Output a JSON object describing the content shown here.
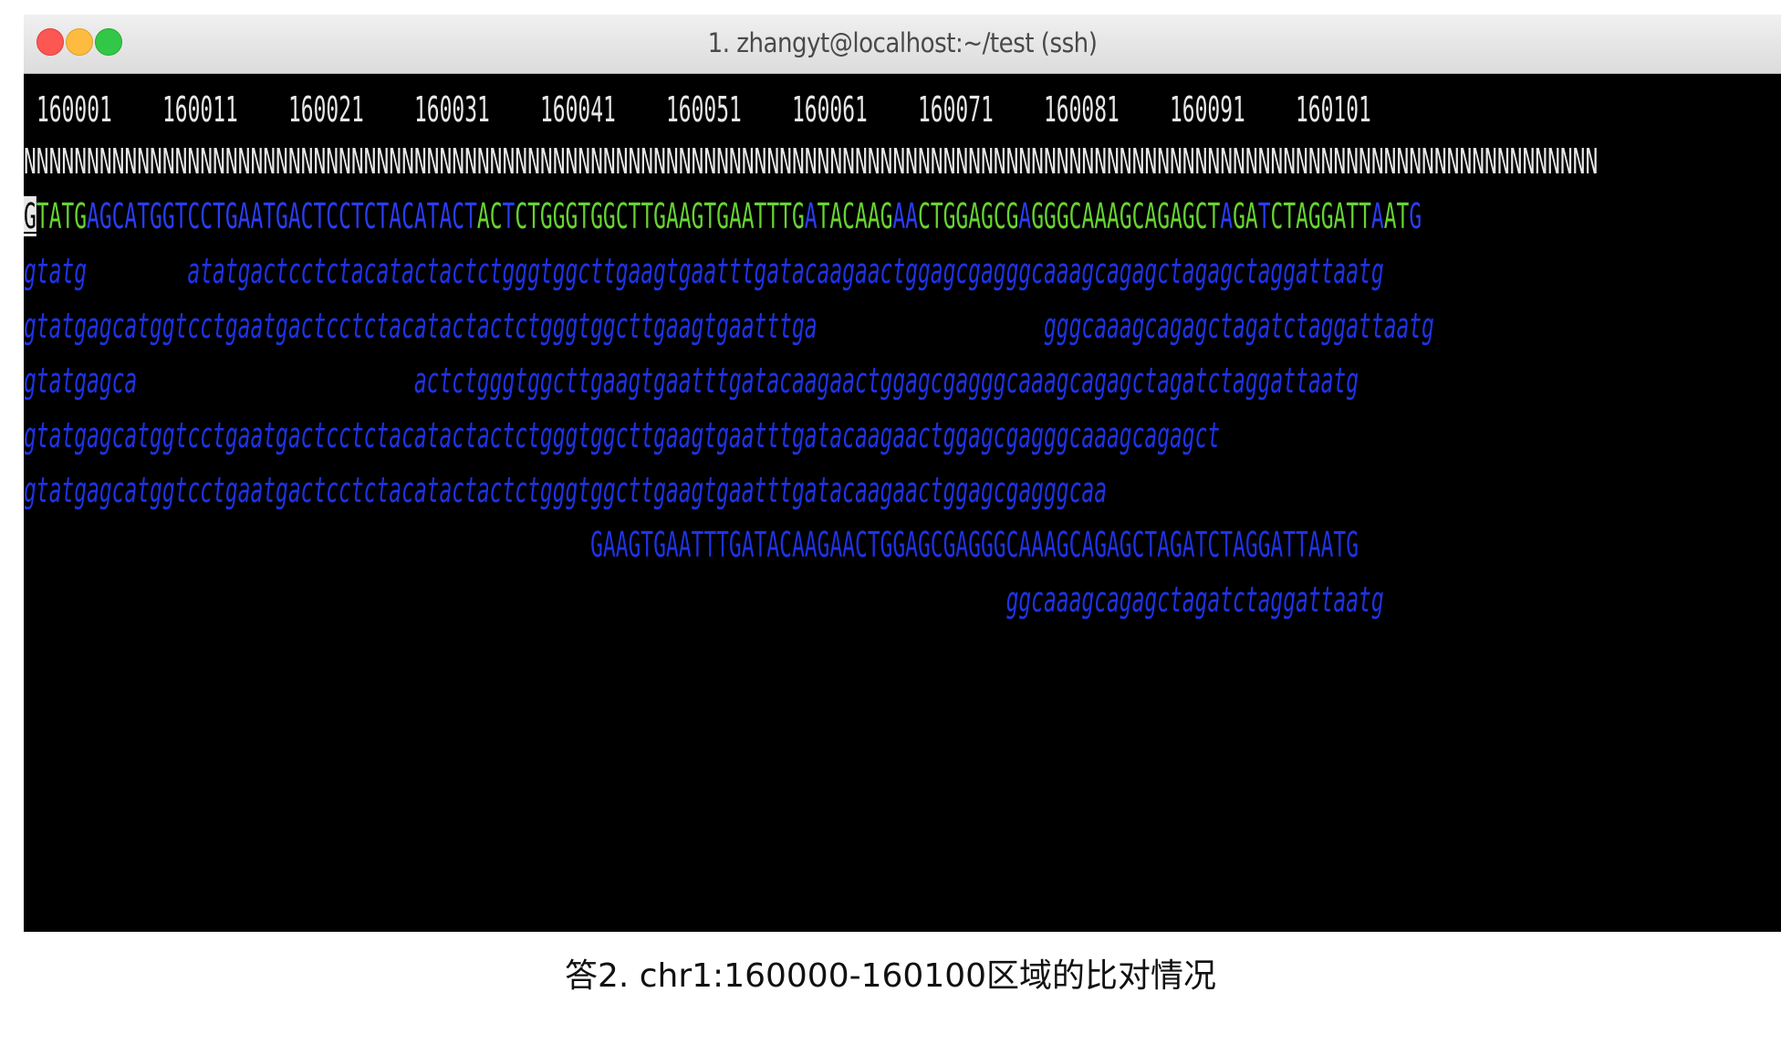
{
  "window": {
    "title": "1. zhangyt@localhost:~/test (ssh)"
  },
  "ruler": [
    "160001",
    "160011",
    "160021",
    "160031",
    "160041",
    "160051",
    "160061",
    "160071",
    "160081",
    "160091",
    "160101"
  ],
  "reference_n": "NNNNNNNNNNNNNNNNNNNNNNNNNNNNNNNNNNNNNNNNNNNNNNNNNNNNNNNNNNNNNNNNNNNNNNNNNNNNNNNNNNNNNNNNNNNNNNNNNNNNNNNNNNNNNNNNNNNNNNNNNNNNN",
  "reference_segments": [
    {
      "text": "G",
      "color": "cursor"
    },
    {
      "text": "TATG",
      "color": "green"
    },
    {
      "text": "AGCATGGTCCTGAATGACTCCTCTACATACT",
      "color": "blue"
    },
    {
      "text": "AC",
      "color": "green"
    },
    {
      "text": "T",
      "color": "blue"
    },
    {
      "text": "CTGGGTGGCTTGAAGTGAATTTG",
      "color": "green"
    },
    {
      "text": "A",
      "color": "blue"
    },
    {
      "text": "TACAAG",
      "color": "green"
    },
    {
      "text": "AA",
      "color": "blue"
    },
    {
      "text": "CTGGAGCG",
      "color": "green"
    },
    {
      "text": "A",
      "color": "blue"
    },
    {
      "text": "GGGCAAAGCAGAGCT",
      "color": "green"
    },
    {
      "text": "A",
      "color": "blue"
    },
    {
      "text": "GA",
      "color": "green"
    },
    {
      "text": "T",
      "color": "blue"
    },
    {
      "text": "CTAGGATT",
      "color": "green"
    },
    {
      "text": "A",
      "color": "blue"
    },
    {
      "text": "AT",
      "color": "green"
    },
    {
      "text": "G",
      "color": "blue"
    }
  ],
  "reads": [
    "gtatg        atatgactcctctacatactactctgggtggcttgaagtgaatttgatacaagaactggagcgagggcaaagcagagctagagctaggattaatg",
    "gtatgagcatggtcctgaatgactcctctacatactactctgggtggcttgaagtgaatttga                  gggcaaagcagagctagatctaggattaatg",
    "gtatgagca                      actctgggtggcttgaagtgaatttgatacaagaactggagcgagggcaaagcagagctagatctaggattaatg",
    "gtatgagcatggtcctgaatgactcctctacatactactctgggtggcttgaagtgaatttgatacaagaactggagcgagggcaaagcagagct",
    "gtatgagcatggtcctgaatgactcctctacatactactctgggtggcttgaagtgaatttgatacaagaactggagcgagggcaa",
    "                                             GAAGTGAATTTGATACAAGAACTGGAGCGAGGGCAAAGCAGAGCTAGATCTAGGATTAATG",
    "                                                                              ggcaaagcagagctagatctaggattaatg"
  ],
  "caption": "答2. chr1:160000-160100区域的比对情况",
  "colors": {
    "terminal_bg": "#000000",
    "match_green": "#66d432",
    "read_blue": "#1f33e6"
  }
}
